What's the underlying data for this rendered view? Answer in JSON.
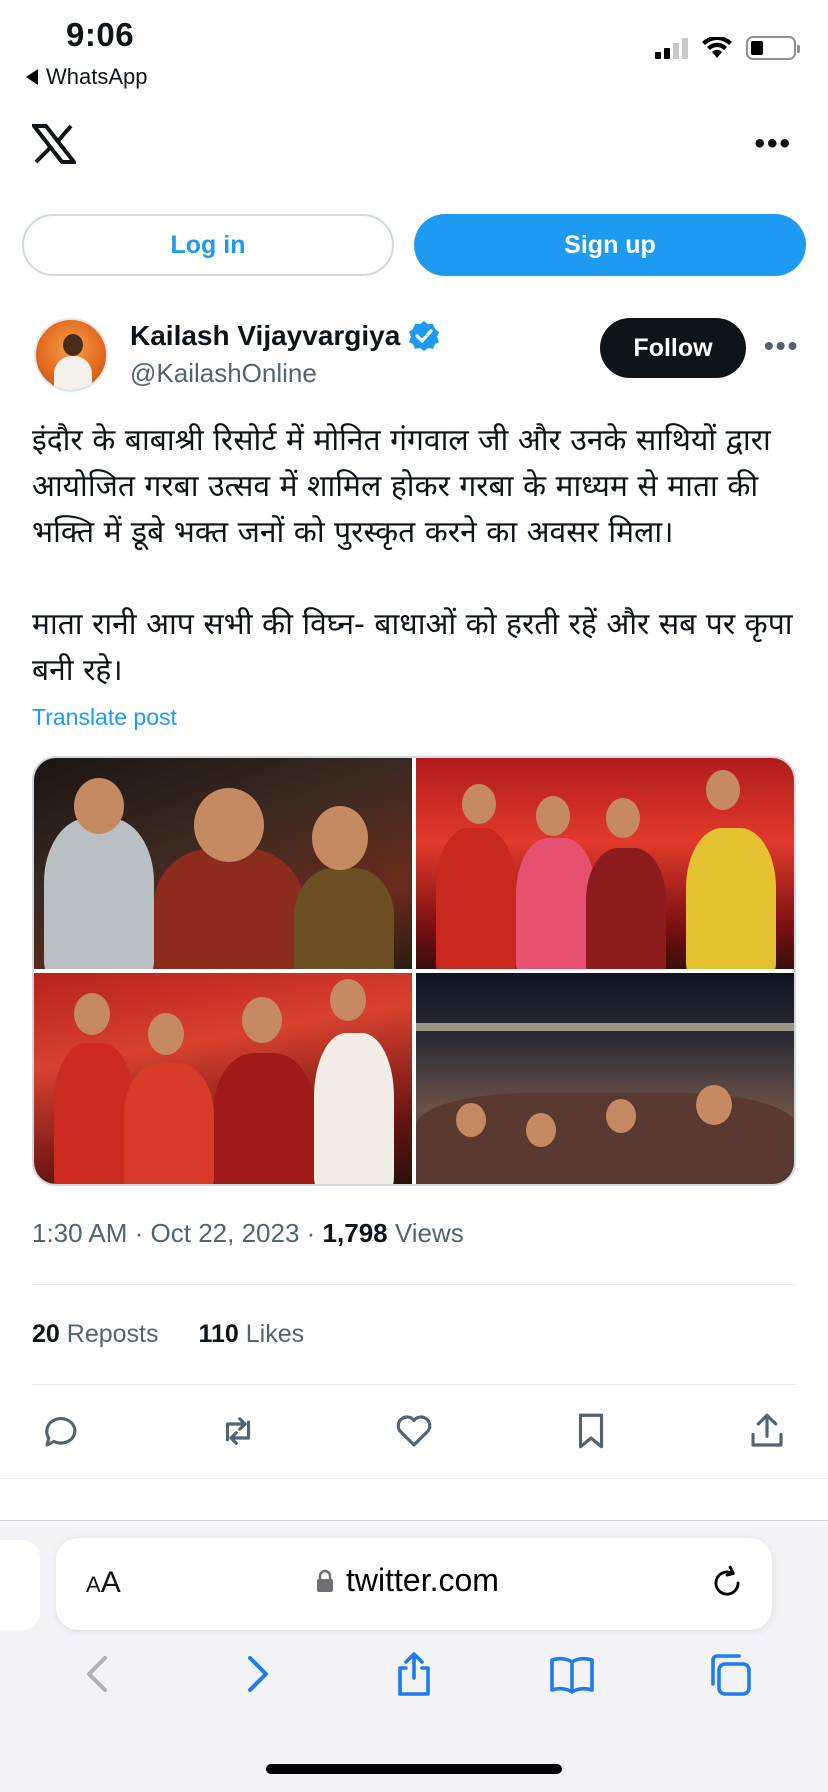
{
  "status_bar": {
    "time": "9:06",
    "back_app": "WhatsApp",
    "signal_bars_active": 2,
    "battery_level_percent": 20
  },
  "header": {
    "logo_icon": "x-logo-icon",
    "more_icon": "more-horizontal-icon"
  },
  "auth": {
    "login_label": "Log in",
    "signup_label": "Sign up",
    "accent_color": "#1d9bf0"
  },
  "tweet": {
    "display_name": "Kailash Vijayvargiya",
    "handle": "@KailashOnline",
    "verified": true,
    "follow_label": "Follow",
    "text": "इंदौर के बाबाश्री रिसोर्ट में मोनित गंगवाल जी और उनके साथियों द्वारा आयोजित गरबा उत्सव में शामिल होकर गरबा के माध्यम से माता की भक्ति में डूबे भक्त जनों को पुरस्कृत करने का अवसर मिला।\n\nमाता रानी आप सभी की विघ्न- बाधाओं को हरती रहें और सब पर कृपा बनी रहे।",
    "translate_label": "Translate post",
    "media_count": 4,
    "time": "1:30 AM",
    "date": "Oct 22, 2023",
    "views_count": "1,798",
    "views_label": "Views",
    "reposts_count": "20",
    "reposts_label": "Reposts",
    "likes_count": "110",
    "likes_label": "Likes",
    "actions": [
      "reply-icon",
      "repost-icon",
      "like-icon",
      "bookmark-icon",
      "share-icon"
    ]
  },
  "browser": {
    "text_size_label_small": "A",
    "text_size_label_large": "A",
    "url": "twitter.com",
    "nav_icons": [
      "back-icon",
      "forward-icon",
      "share-sheet-icon",
      "bookmarks-icon",
      "tabs-icon"
    ]
  }
}
